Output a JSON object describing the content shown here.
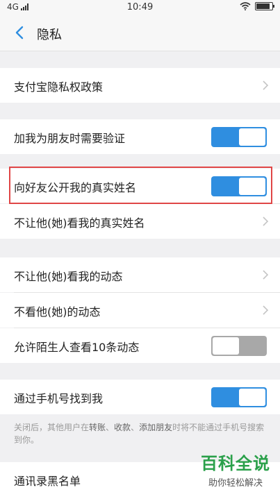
{
  "status_bar": {
    "network": "4G",
    "time": "10:49",
    "battery_level": 0.85
  },
  "navbar": {
    "title": "隐私"
  },
  "rows": {
    "alipay_privacy_policy": "支付宝隐私权政策",
    "verify_when_adding": "加我为朋友时需要验证",
    "show_real_name": "向好友公开我的真实姓名",
    "hide_real_name_from": "不让他(她)看我的真实姓名",
    "hide_moments_from": "不让他(她)看我的动态",
    "dont_see_moments": "不看他(她)的动态",
    "stranger_view_10": "允许陌生人查看10条动态",
    "find_by_phone": "通过手机号找到我",
    "contacts_blacklist": "通讯录黑名单"
  },
  "toggles": {
    "verify_when_adding": true,
    "show_real_name": true,
    "stranger_view_10": false,
    "find_by_phone": true
  },
  "note": {
    "part1": "关闭后，其他用户在",
    "kw1": "转账",
    "sep1": "、",
    "kw2": "收款",
    "sep2": "、",
    "kw3": "添加朋友",
    "part2": "时将不能通过手机号搜索到你。"
  },
  "watermark": {
    "title": "百科全说",
    "subtitle": "助你轻松解决"
  },
  "colors": {
    "accent": "#2f8ee0",
    "highlight": "#e04646",
    "watermark_green": "#2aa04a"
  }
}
